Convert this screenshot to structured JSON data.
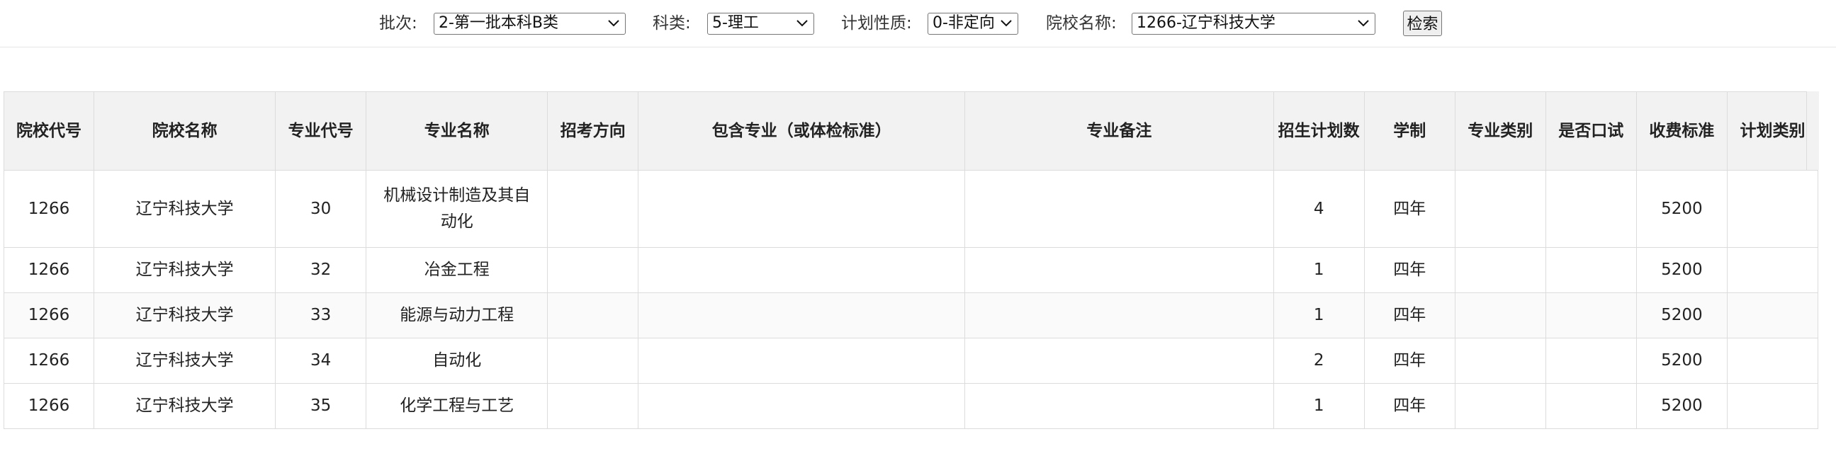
{
  "filters": {
    "batch_label": "批次:",
    "batch_value": "2-第一批本科B类",
    "category_label": "科类:",
    "category_value": "5-理工",
    "plan_nature_label": "计划性质:",
    "plan_nature_value": "0-非定向",
    "school_label": "院校名称:",
    "school_value": "1266-辽宁科技大学",
    "search_button": "检索",
    "dropdown_icon": "chevron-down-icon"
  },
  "table": {
    "headers": {
      "school_code": "院校代号",
      "school_name": "院校名称",
      "major_code": "专业代号",
      "major_name": "专业名称",
      "direction": "招考方向",
      "included": "包含专业（或体检标准）",
      "remarks": "专业备注",
      "plan_count": "招生计划数",
      "duration": "学制",
      "major_type": "专业类别",
      "oral_test": "是否口试",
      "fee": "收费标准",
      "plan_type": "计划类别"
    },
    "rows": [
      {
        "school_code": "1266",
        "school_name": "辽宁科技大学",
        "major_code": "30",
        "major_name": "机械设计制造及其自动化",
        "direction": "",
        "included": "",
        "remarks": "",
        "plan_count": "4",
        "duration": "四年",
        "major_type": "",
        "oral_test": "",
        "fee": "5200",
        "plan_type": ""
      },
      {
        "school_code": "1266",
        "school_name": "辽宁科技大学",
        "major_code": "32",
        "major_name": "冶金工程",
        "direction": "",
        "included": "",
        "remarks": "",
        "plan_count": "1",
        "duration": "四年",
        "major_type": "",
        "oral_test": "",
        "fee": "5200",
        "plan_type": ""
      },
      {
        "school_code": "1266",
        "school_name": "辽宁科技大学",
        "major_code": "33",
        "major_name": "能源与动力工程",
        "direction": "",
        "included": "",
        "remarks": "",
        "plan_count": "1",
        "duration": "四年",
        "major_type": "",
        "oral_test": "",
        "fee": "5200",
        "plan_type": ""
      },
      {
        "school_code": "1266",
        "school_name": "辽宁科技大学",
        "major_code": "34",
        "major_name": "自动化",
        "direction": "",
        "included": "",
        "remarks": "",
        "plan_count": "2",
        "duration": "四年",
        "major_type": "",
        "oral_test": "",
        "fee": "5200",
        "plan_type": ""
      },
      {
        "school_code": "1266",
        "school_name": "辽宁科技大学",
        "major_code": "35",
        "major_name": "化学工程与工艺",
        "direction": "",
        "included": "",
        "remarks": "",
        "plan_count": "1",
        "duration": "四年",
        "major_type": "",
        "oral_test": "",
        "fee": "5200",
        "plan_type": ""
      }
    ]
  }
}
